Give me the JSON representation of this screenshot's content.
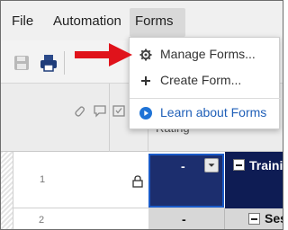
{
  "menubar": {
    "items": [
      "File",
      "Automation",
      "Forms"
    ]
  },
  "forms_menu": {
    "items": [
      {
        "label": "Manage Forms...",
        "icon": "gear-icon"
      },
      {
        "label": "Create Form...",
        "icon": "plus-icon"
      },
      {
        "label": "Learn about Forms",
        "icon": "play-circle-icon"
      }
    ]
  },
  "grid": {
    "column_header_partial": "Rating",
    "rows": [
      {
        "number": "1",
        "cell_value": "-",
        "primary": "Traini"
      },
      {
        "number": "2",
        "cell_value": "-",
        "primary": "Ses"
      }
    ]
  },
  "colors": {
    "menubar_bg": "#f0f0f0",
    "selected_cell": "#1c2e6e",
    "header_row_dark": "#0e1c54",
    "section_row_gray": "#d7d7d7",
    "learn_link": "#1f5fb8",
    "annotation_arrow": "#e0131b"
  }
}
